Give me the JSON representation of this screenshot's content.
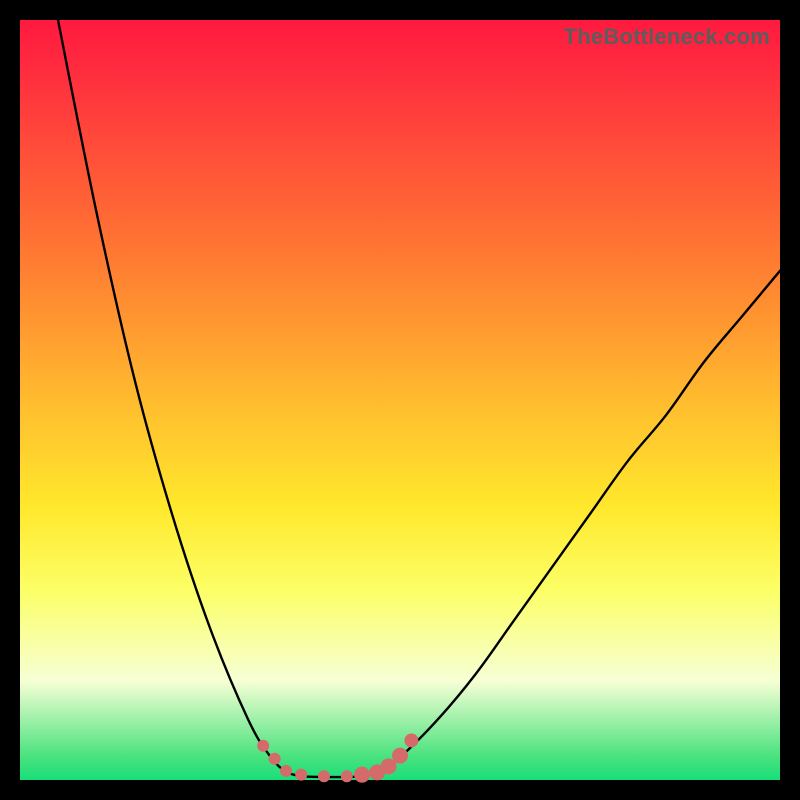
{
  "watermark": "TheBottleneck.com",
  "chart_data": {
    "type": "line",
    "title": "",
    "xlabel": "",
    "ylabel": "",
    "xlim": [
      0,
      100
    ],
    "ylim": [
      0,
      100
    ],
    "grid": false,
    "series": [
      {
        "name": "curve-left",
        "x": [
          5,
          10,
          15,
          20,
          25,
          30,
          33,
          35
        ],
        "values": [
          100,
          75,
          53,
          35,
          20,
          8,
          3,
          1
        ]
      },
      {
        "name": "curve-right",
        "x": [
          47,
          50,
          55,
          60,
          65,
          70,
          75,
          80,
          85,
          90,
          95,
          100
        ],
        "values": [
          1,
          3,
          8,
          14,
          21,
          28,
          35,
          42,
          48,
          55,
          61,
          67
        ]
      },
      {
        "name": "flat-bottom",
        "x": [
          35,
          37,
          40,
          43,
          45,
          47
        ],
        "values": [
          1,
          0.5,
          0.4,
          0.4,
          0.5,
          1
        ]
      }
    ],
    "markers": {
      "name": "bottom-dots",
      "color": "#d46a6a",
      "x": [
        32,
        33.5,
        35,
        37,
        40,
        43,
        45,
        47,
        48.5,
        50,
        51.5
      ],
      "values": [
        4.5,
        2.8,
        1.2,
        0.7,
        0.5,
        0.5,
        0.7,
        1.0,
        1.8,
        3.2,
        5.2
      ],
      "radius": [
        6,
        6,
        6,
        6,
        6,
        6,
        8,
        8,
        8,
        8,
        7
      ]
    }
  }
}
